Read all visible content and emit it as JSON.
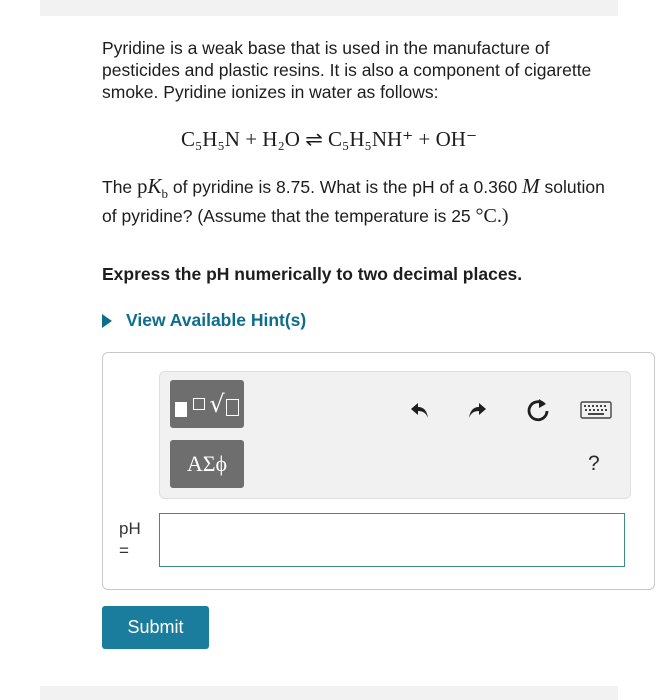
{
  "question": {
    "paragraph1": "Pyridine is a weak base that is used in the manufacture of pesticides and plastic resins. It is also a component of cigarette smoke. Pyridine ionizes in water as follows:",
    "equation": "C₅H₅N + H₂O ⇌ C₅H₅NH⁺ + OH⁻",
    "p2_before": "The",
    "p2_pkb_p": "p",
    "p2_pkb_k": "K",
    "p2_pkb_sub": "b",
    "p2_middle": "of pyridine is 8.75. What is the pH of a 0.360",
    "p2_unit": "M",
    "p2_after": "solution of pyridine? (Assume that the temperature is 25",
    "p2_temp": "°C.)",
    "instruction": "Express the pH numerically to two decimal places."
  },
  "hint": {
    "label": "View Available Hint(s)"
  },
  "toolbar": {
    "greek_label": "ΑΣϕ",
    "help_label": "?"
  },
  "answer": {
    "label_line1": "pH",
    "label_line2": "=",
    "value": ""
  },
  "submit": {
    "label": "Submit"
  },
  "icons": {
    "templates": "math-templates-icon",
    "undo": "undo-icon",
    "redo": "redo-icon",
    "reset": "reset-icon",
    "keyboard": "keyboard-icon"
  },
  "colors": {
    "link": "#0d6e8b",
    "submit_bg": "#1a7d9d",
    "tool_button": "#6e6e6e",
    "input_border": "#3b8a86"
  }
}
